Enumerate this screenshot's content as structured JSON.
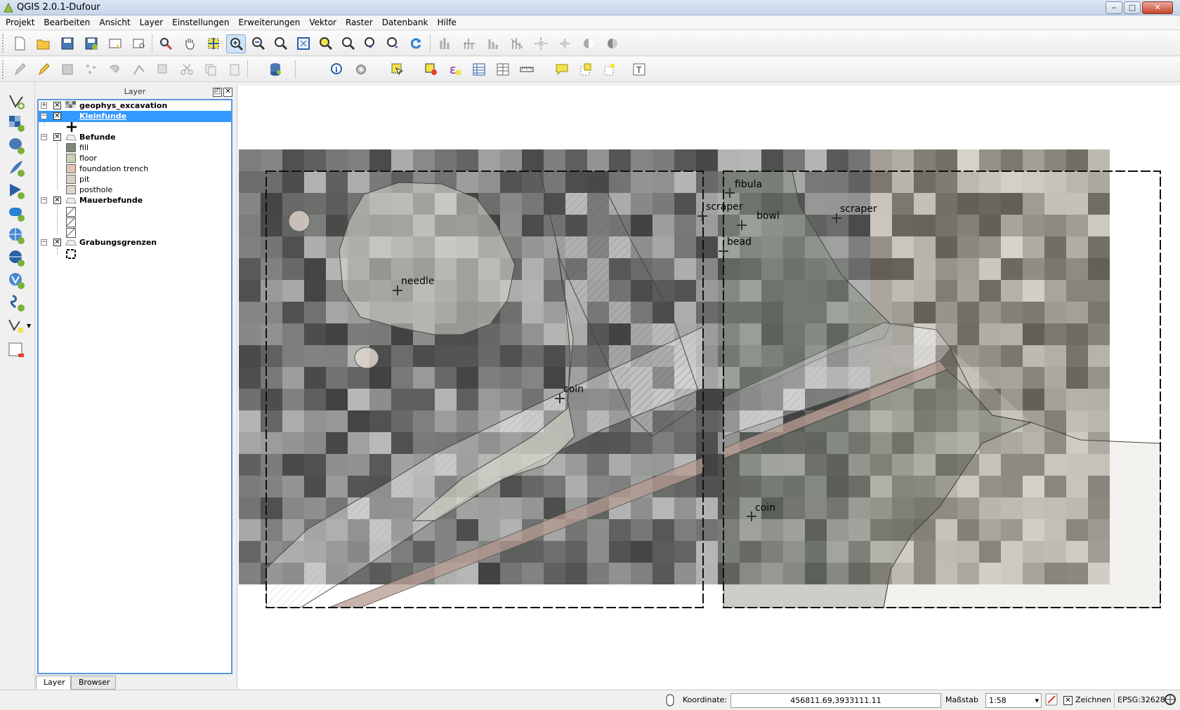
{
  "window": {
    "title": "QGIS 2.0.1-Dufour",
    "buttons": {
      "minimize": "‒",
      "maximize": "□",
      "close": "✕"
    }
  },
  "menu": [
    "Projekt",
    "Bearbeiten",
    "Ansicht",
    "Layer",
    "Einstellungen",
    "Erweiterungen",
    "Vektor",
    "Raster",
    "Datenbank",
    "Hilfe"
  ],
  "toolbar1": [
    "new-project-icon",
    "open-project-icon",
    "save-project-icon",
    "save-as-icon",
    "new-print-composer-icon",
    "composer-manager-icon",
    "pan-to-selection-icon",
    "pan-icon",
    "pan-map-to-selection-icon",
    "zoom-in-icon",
    "zoom-out-icon",
    "zoom-actual-icon",
    "zoom-full-icon",
    "zoom-to-selection-icon",
    "zoom-to-layer-icon",
    "zoom-last-icon",
    "zoom-next-icon",
    "refresh-icon"
  ],
  "layer_panel": {
    "title": "Layer",
    "layers": [
      {
        "name": "geophys_excavation",
        "checked": true,
        "type": "raster"
      },
      {
        "name": "Kleinfunde",
        "checked": true,
        "type": "point",
        "selected": true
      },
      {
        "name": "Befunde",
        "checked": true,
        "type": "polygon",
        "classes": [
          {
            "label": "fill",
            "color": "#7f8878"
          },
          {
            "label": "floor",
            "color": "#c8d2b9"
          },
          {
            "label": "foundation trench",
            "color": "#e3c3b4"
          },
          {
            "label": "pit",
            "color": "#d8cfc6"
          },
          {
            "label": "posthole",
            "color": "#ddd5cc"
          }
        ]
      },
      {
        "name": "Mauerbefunde",
        "checked": true,
        "type": "polygon"
      },
      {
        "name": "Grabungsgrenzen",
        "checked": true,
        "type": "line"
      }
    ],
    "tabs": [
      "Layer",
      "Browser"
    ]
  },
  "map": {
    "labels": [
      "needle",
      "coin",
      "fibula",
      "scraper",
      "bowl",
      "scraper",
      "bead",
      "coin"
    ]
  },
  "statusbar": {
    "coord_label": "Koordinate:",
    "coord_value": "456811.69,3933111.11",
    "scale_label": "Maßstab",
    "scale_value": "1:58",
    "render_label": "Zeichnen",
    "crs": "EPSG:32628"
  }
}
